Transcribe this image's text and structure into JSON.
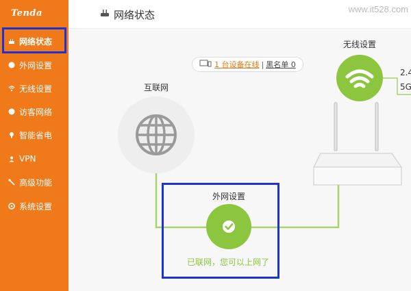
{
  "sidebar": {
    "logo": "Tenda",
    "items": [
      {
        "label": "网络状态",
        "icon": "router-icon"
      },
      {
        "label": "外网设置",
        "icon": "globe-icon"
      },
      {
        "label": "无线设置",
        "icon": "wifi-icon"
      },
      {
        "label": "访客网络",
        "icon": "guest-icon"
      },
      {
        "label": "智能省电",
        "icon": "bulb-icon"
      },
      {
        "label": "VPN",
        "icon": "vpn-icon"
      },
      {
        "label": "高级功能",
        "icon": "wrench-icon"
      },
      {
        "label": "系统设置",
        "icon": "gear-icon"
      }
    ],
    "active_index": 0
  },
  "header": {
    "title": "网络状态",
    "icon": "router-icon",
    "watermark": "www.it528.com"
  },
  "device_bar": {
    "icon": "device-icon",
    "online_text": "1 台设备在线",
    "separator": "|",
    "blacklist_text": "黑名单 0"
  },
  "topology": {
    "internet_label": "互联网",
    "wireless_label": "无线设置",
    "wan_label": "外网设置",
    "wan_status": "已联网，您可以上网了",
    "band_24_partial": "2.4",
    "band_5_partial": "5G"
  },
  "colors": {
    "sidebar": "#f07a1a",
    "accent_green": "#8cc63f",
    "highlight_box": "#1b33d6",
    "link_orange": "#e07a14"
  }
}
